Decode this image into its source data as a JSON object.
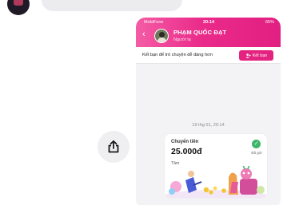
{
  "outer": {
    "avatar_icon": "contact-avatar",
    "share_icon": "share-icon"
  },
  "phone": {
    "status_bar": {
      "carrier": "MobiFone",
      "time": "20:14",
      "battery": "65%"
    },
    "header": {
      "back_icon": "chevron-left-icon",
      "name": "PHẠM QUỐC ĐẠT",
      "subtitle": "Người lạ",
      "color": "#e8308a"
    },
    "friend_bar": {
      "text": "Kết bạn để trò chuyện dễ dàng hơn",
      "button_label": "Kết bạn",
      "button_color": "#e3237f"
    },
    "chat": {
      "timestamp": "19 thg 01, 20:14",
      "transfer_card": {
        "title": "Chuyển tiền",
        "amount": "25.000đ",
        "note": "Tâm",
        "status": "Đã gửi",
        "status_color": "#3db66b"
      }
    }
  }
}
